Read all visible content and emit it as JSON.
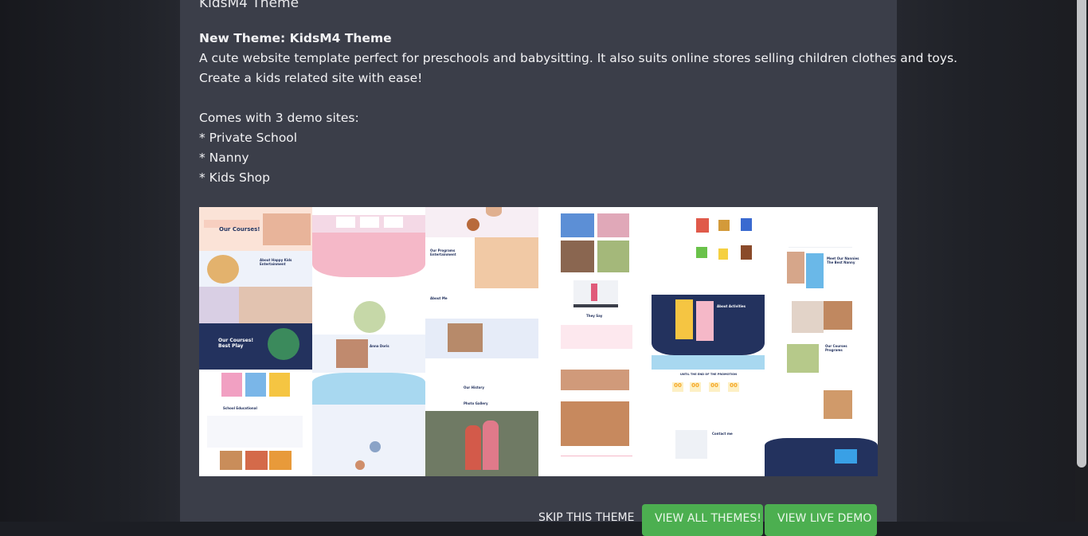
{
  "modal": {
    "title": "KidsM4 Theme",
    "headline": "New Theme: KidsM4 Theme",
    "description_line1": "A cute website template perfect for preschools and babysitting. It also suits online stores selling children clothes and toys.",
    "description_line2": "Create a kids related site with ease!",
    "demo_intro": "Comes with 3 demo sites:",
    "demo_sites": [
      "* Private School",
      "* Nanny",
      "* Kids Shop"
    ]
  },
  "preview": {
    "texts": {
      "our_courses": "Our Courses!",
      "about_happy_kids": "About Happy Kids Entertainment",
      "our_courses_best_play": "Our Courses! Best Play",
      "school_educational": "School Educational",
      "anna_doris": "Anna Doris",
      "our_programs": "Our Programs Entertainment",
      "about_me": "About Me",
      "our_history": "Our History",
      "photo_gallery": "Photo Gallery",
      "they_say": "They Say",
      "about_activities": "About Activities",
      "until_promotion": "UNTIL THE END OF THE PROMOTION",
      "countdown": [
        "00",
        "00",
        "00",
        "00"
      ],
      "contact_me": "Contact me",
      "meet_our_nannies": "Meet Our Nannies The Best Nanny",
      "our_courses_programs": "Our Courses Programs"
    }
  },
  "footer": {
    "skip_label": "SKIP THIS THEME",
    "view_all_label": "VIEW ALL THEMES!",
    "view_live_label": "VIEW LIVE DEMO"
  },
  "colors": {
    "modal_bg": "#3b3e49",
    "button_green": "#4caf50",
    "navy": "#23325e",
    "pink": "#f5b8c8",
    "light_blue": "#a8d8f0",
    "yellow": "#f5c542"
  }
}
